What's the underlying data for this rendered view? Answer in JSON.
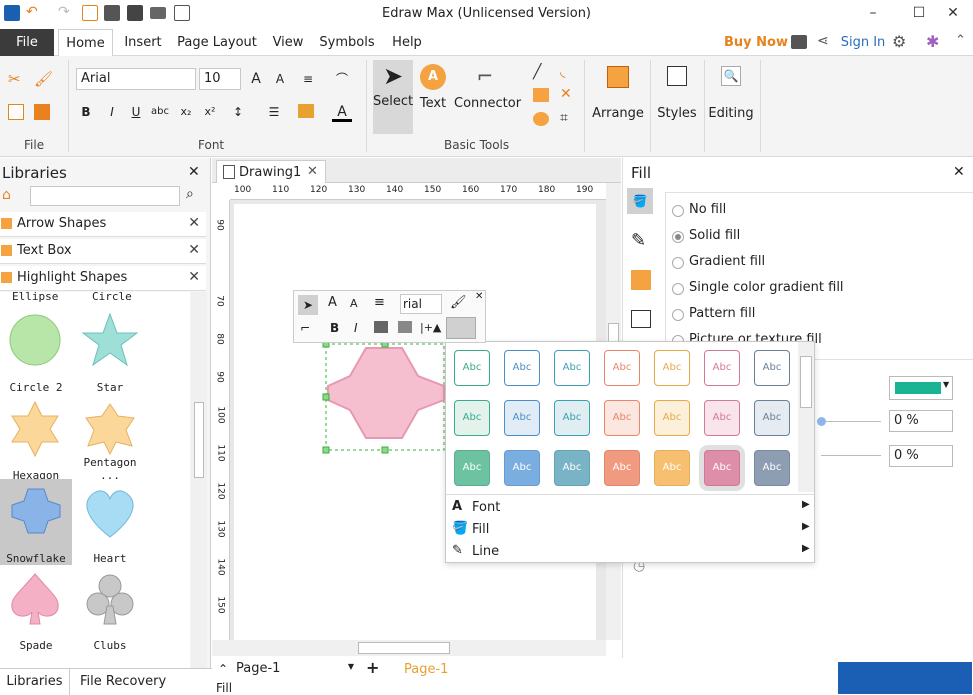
{
  "window": {
    "title": "Edraw Max (Unlicensed Version)"
  },
  "tabs": {
    "file": "File",
    "home": "Home",
    "insert": "Insert",
    "page_layout": "Page Layout",
    "view": "View",
    "symbols": "Symbols",
    "help": "Help"
  },
  "topright": {
    "buy_now": "Buy Now",
    "sign_in": "Sign In"
  },
  "ribbon": {
    "font_name": "Arial",
    "font_size": "10",
    "select": "Select",
    "text": "Text",
    "connector": "Connector",
    "arrange": "Arrange",
    "styles": "Styles",
    "editing": "Editing",
    "groups": {
      "file": "File",
      "font": "Font",
      "basic_tools": "Basic Tools"
    }
  },
  "libraries": {
    "title": "Libraries",
    "sections": [
      "Arrow Shapes",
      "Text Box",
      "Highlight Shapes"
    ],
    "shapes": [
      "Ellipse",
      "Circle",
      "Circle 2",
      "Star",
      "Hexagon",
      "Pentagon ...",
      "Snowflake",
      "Heart",
      "Spade",
      "Clubs"
    ],
    "bottom_tabs": [
      "Libraries",
      "File Recovery"
    ]
  },
  "document": {
    "tab": "Drawing1",
    "ruler_h": [
      "100",
      "110",
      "120",
      "130",
      "140",
      "150",
      "160",
      "170",
      "180",
      "190"
    ],
    "ruler_v": [
      "90",
      "80",
      "70",
      "80",
      "90",
      "100",
      "110",
      "120",
      "130",
      "140",
      "150",
      "160"
    ],
    "page_tab": "Page-1",
    "page_active": "Page-1",
    "fill_label": "Fill"
  },
  "minitoolbar": {
    "font": "rial"
  },
  "fillpanel": {
    "title": "Fill",
    "options": [
      "No fill",
      "Solid fill",
      "Gradient fill",
      "Single color gradient fill",
      "Pattern fill",
      "Picture or texture fill"
    ],
    "selected": "Solid fill",
    "color": "#1ab394",
    "percent1": "0 %",
    "percent2": "0 %"
  },
  "popup": {
    "swatch_label": "Abc",
    "rows": [
      {
        "bg": "#ffffff",
        "borders": [
          "#3aaa8c",
          "#4a8fc9",
          "#3a9fb5",
          "#e8866b",
          "#e8a84a",
          "#d4789a",
          "#6a7f99"
        ]
      },
      {
        "bg_list": [
          "#e3f3ec",
          "#e1ecf7",
          "#e0eef2",
          "#fbe7df",
          "#fdf0db",
          "#f9e4ec",
          "#e6ebf1"
        ],
        "borders": [
          "#3aaa8c",
          "#4a8fc9",
          "#3a9fb5",
          "#e8866b",
          "#e8a84a",
          "#d4789a",
          "#6a7f99"
        ]
      },
      {
        "bg_list": [
          "#6dc3a1",
          "#7baee0",
          "#78b4c6",
          "#f09b80",
          "#f6c070",
          "#de8ea9",
          "#8d9db2"
        ],
        "borders": [
          "#5aae8e",
          "#689bd0",
          "#65a2b5",
          "#de8870",
          "#e4ae5e",
          "#cc7b96",
          "#7a8aa0"
        ]
      }
    ],
    "menu": [
      "Font",
      "Fill",
      "Line"
    ]
  },
  "colors": {
    "accent": "#e8821e",
    "filetab": "#3b3b3b",
    "signin": "#2a6ebb"
  }
}
